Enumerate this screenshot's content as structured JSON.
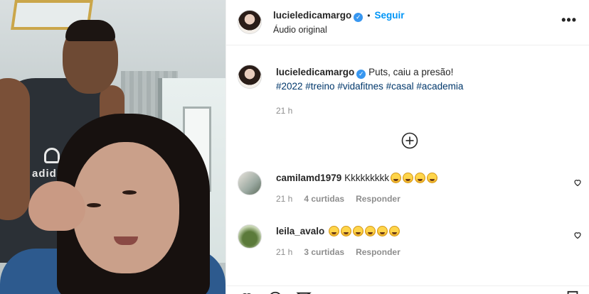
{
  "post": {
    "author": "lucieledicamargo",
    "follow_label": "Seguir",
    "separator": "•",
    "audio": "Áudio original",
    "more_label": "•••"
  },
  "caption": {
    "username": "lucieledicamargo",
    "text": "Puts, caiu a presão!",
    "hashtags": "#2022 #treino #vidafitnes #casal #academia",
    "time": "21 h"
  },
  "comments": [
    {
      "username": "camilamd1979",
      "text": "Kkkkkkkkk",
      "emoji_count": 4,
      "time": "21 h",
      "likes": "4 curtidas",
      "reply": "Responder"
    },
    {
      "username": "leila_avalo",
      "text": "",
      "emoji_count": 6,
      "time": "21 h",
      "likes": "3 curtidas",
      "reply": "Responder"
    }
  ],
  "media": {
    "shirt_logo": "adidas"
  },
  "colors": {
    "accent": "#0095f6",
    "verified": "#3897f0",
    "hashtag": "#00376b",
    "meta": "#8e8e8e"
  }
}
